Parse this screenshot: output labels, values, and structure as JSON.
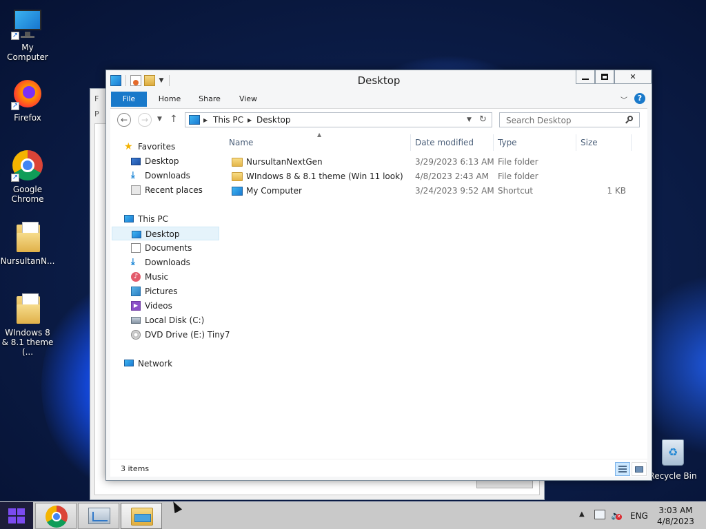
{
  "desktop": {
    "icons": [
      {
        "label": "My Computer"
      },
      {
        "label": "Firefox"
      },
      {
        "label": "Google Chrome"
      },
      {
        "label": "NursultanN..."
      },
      {
        "label": "WIndows 8 & 8.1 theme (..."
      },
      {
        "label": "Recycle Bin"
      }
    ]
  },
  "window": {
    "title": "Desktop",
    "ribbon_tabs": [
      "File",
      "Home",
      "Share",
      "View"
    ],
    "help_label": "?",
    "address": {
      "crumbs": [
        "This PC",
        "Desktop"
      ]
    },
    "search_placeholder": "Search Desktop",
    "nav": {
      "favorites": "Favorites",
      "fav_items": [
        "Desktop",
        "Downloads",
        "Recent places"
      ],
      "this_pc": "This PC",
      "pc_items": [
        "Desktop",
        "Documents",
        "Downloads",
        "Music",
        "Pictures",
        "Videos",
        "Local Disk (C:)",
        "DVD Drive (E:) Tiny7"
      ],
      "network": "Network"
    },
    "columns": [
      "Name",
      "Date modified",
      "Type",
      "Size"
    ],
    "files": [
      {
        "name": "NursultanNextGen",
        "date": "3/29/2023 6:13 AM",
        "type": "File folder",
        "size": ""
      },
      {
        "name": "WIndows 8 & 8.1 theme (Win 11 look)",
        "date": "4/8/2023 2:43 AM",
        "type": "File folder",
        "size": ""
      },
      {
        "name": "My Computer",
        "date": "3/24/2023 9:52 AM",
        "type": "Shortcut",
        "size": "1 KB"
      }
    ],
    "status": "3 items"
  },
  "taskbar": {
    "language": "ENG",
    "time": "3:03 AM",
    "date": "4/8/2023"
  },
  "colors": {
    "accent": "#1979ca",
    "selection": "#e5f3fb",
    "taskbar": "#c9c9c9"
  }
}
